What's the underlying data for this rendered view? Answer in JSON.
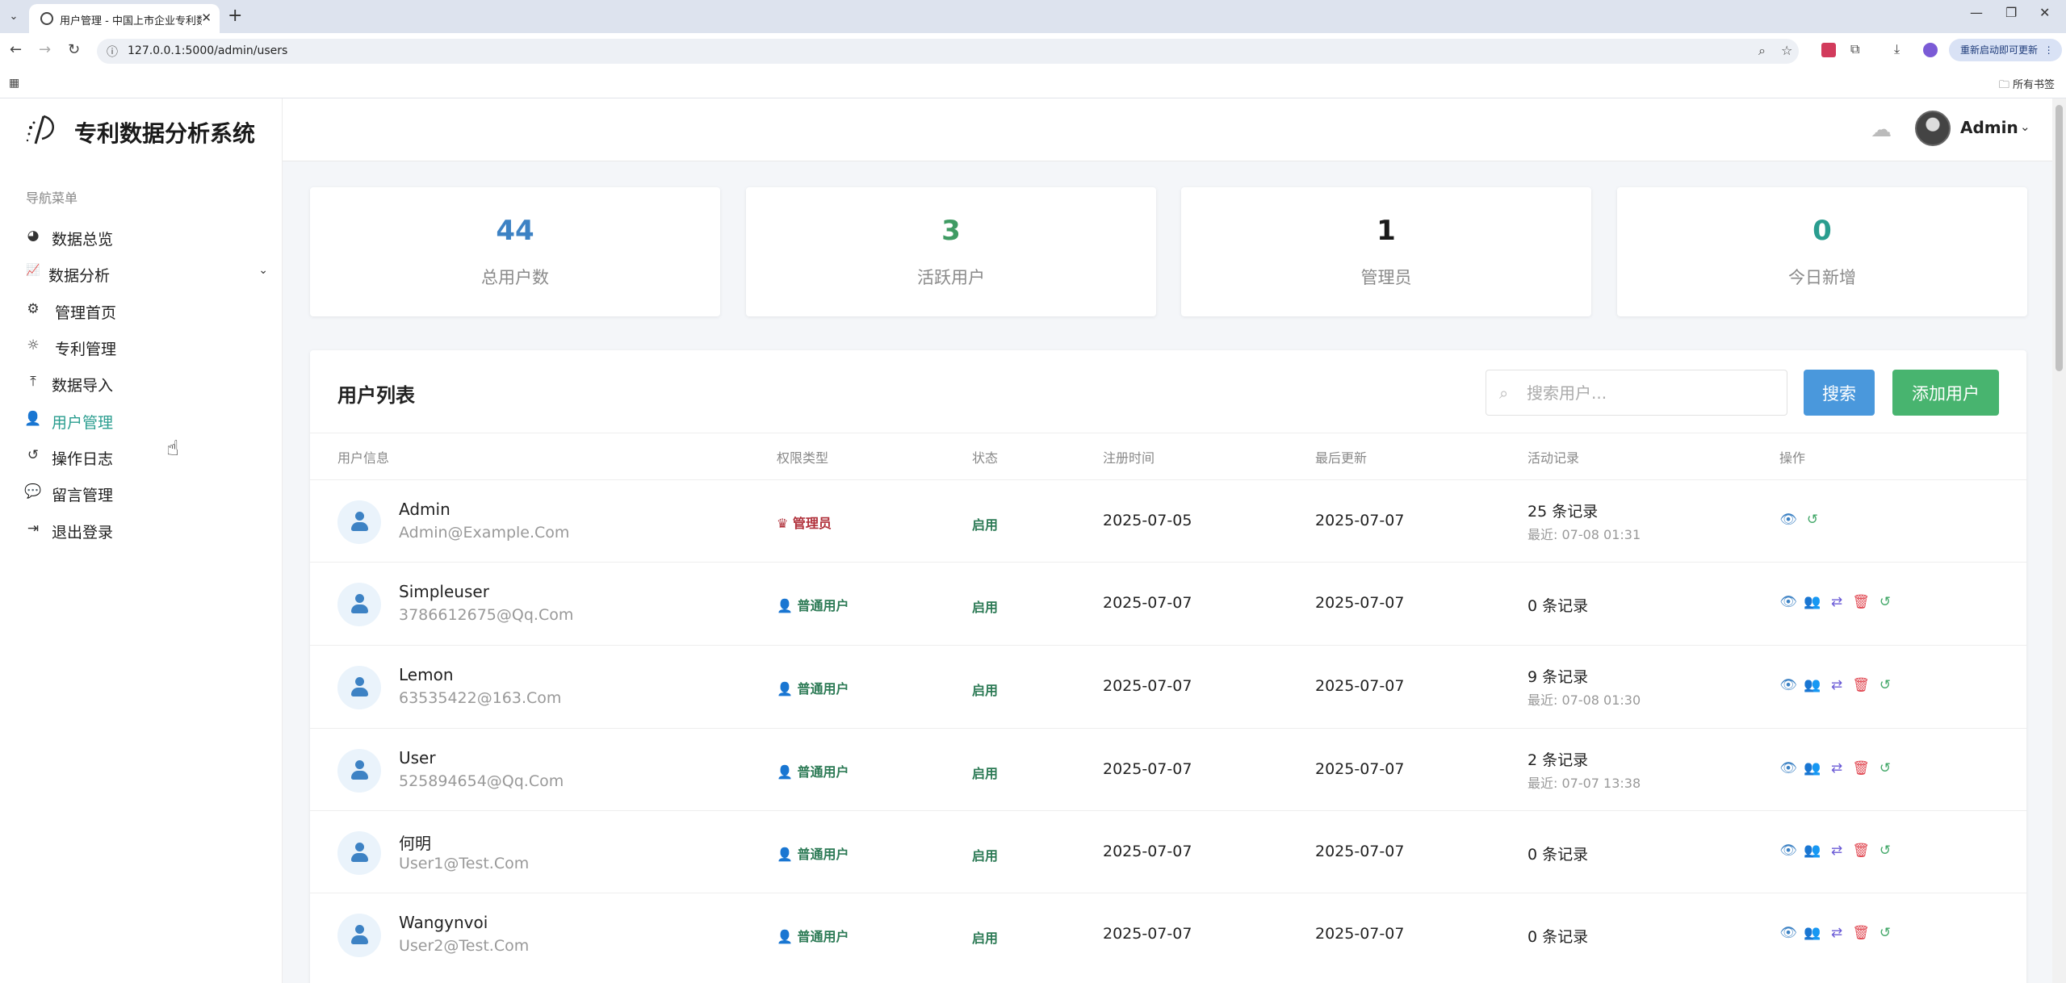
{
  "browser": {
    "tab_title": "用户管理 - 中国上市企业专利数据",
    "url": "127.0.0.1:5000/admin/users",
    "relaunch_label": "重新启动即可更新",
    "bookmarks_label": "所有书签"
  },
  "app": {
    "title": "专利数据分析系统",
    "nav_caption": "导航菜单",
    "nav": [
      {
        "label": "数据总览",
        "icon": "pie-chart-icon"
      },
      {
        "label": "数据分析",
        "icon": "line-chart-icon"
      },
      {
        "label": "管理首页",
        "icon": "gears-icon"
      },
      {
        "label": "专利管理",
        "icon": "lightbulb-icon"
      },
      {
        "label": "数据导入",
        "icon": "upload-icon"
      },
      {
        "label": "用户管理",
        "icon": "user-gear-icon"
      },
      {
        "label": "操作日志",
        "icon": "history-icon"
      },
      {
        "label": "留言管理",
        "icon": "comments-icon"
      },
      {
        "label": "退出登录",
        "icon": "logout-icon"
      }
    ],
    "active_nav": "用户管理",
    "user_name": "Admin",
    "accent_color": "#2a9d8f"
  },
  "stats": [
    {
      "value": "44",
      "label": "总用户数",
      "color": "#3d82c4"
    },
    {
      "value": "3",
      "label": "活跃用户",
      "color": "#3f9b63"
    },
    {
      "value": "1",
      "label": "管理员",
      "color": "#1a1a1a"
    },
    {
      "value": "0",
      "label": "今日新增",
      "color": "#2a9d8f"
    }
  ],
  "user_list": {
    "title": "用户列表",
    "search_placeholder": "搜索用户...",
    "search_button": "搜索",
    "add_button": "添加用户",
    "columns": [
      "用户信息",
      "权限类型",
      "状态",
      "注册时间",
      "最后更新",
      "活动记录",
      "操作"
    ],
    "rows": [
      {
        "name": "Admin",
        "email": "Admin@Example.Com",
        "role": "管理员",
        "role_type": "admin",
        "status": "启用",
        "registered": "2025-07-05",
        "updated": "2025-07-07",
        "activity": "25 条记录",
        "last_activity": "最近: 07-08 01:31"
      },
      {
        "name": "Simpleuser",
        "email": "3786612675@Qq.Com",
        "role": "普通用户",
        "role_type": "user",
        "status": "启用",
        "registered": "2025-07-07",
        "updated": "2025-07-07",
        "activity": "0 条记录",
        "last_activity": ""
      },
      {
        "name": "Lemon",
        "email": "63535422@163.Com",
        "role": "普通用户",
        "role_type": "user",
        "status": "启用",
        "registered": "2025-07-07",
        "updated": "2025-07-07",
        "activity": "9 条记录",
        "last_activity": "最近: 07-08 01:30"
      },
      {
        "name": "User",
        "email": "525894654@Qq.Com",
        "role": "普通用户",
        "role_type": "user",
        "status": "启用",
        "registered": "2025-07-07",
        "updated": "2025-07-07",
        "activity": "2 条记录",
        "last_activity": "最近: 07-07 13:38"
      },
      {
        "name": "何明",
        "email": "User1@Test.Com",
        "role": "普通用户",
        "role_type": "user",
        "status": "启用",
        "registered": "2025-07-07",
        "updated": "2025-07-07",
        "activity": "0 条记录",
        "last_activity": ""
      },
      {
        "name": "Wangynvoi",
        "email": "User2@Test.Com",
        "role": "普通用户",
        "role_type": "user",
        "status": "启用",
        "registered": "2025-07-07",
        "updated": "2025-07-07",
        "activity": "0 条记录",
        "last_activity": ""
      }
    ]
  }
}
